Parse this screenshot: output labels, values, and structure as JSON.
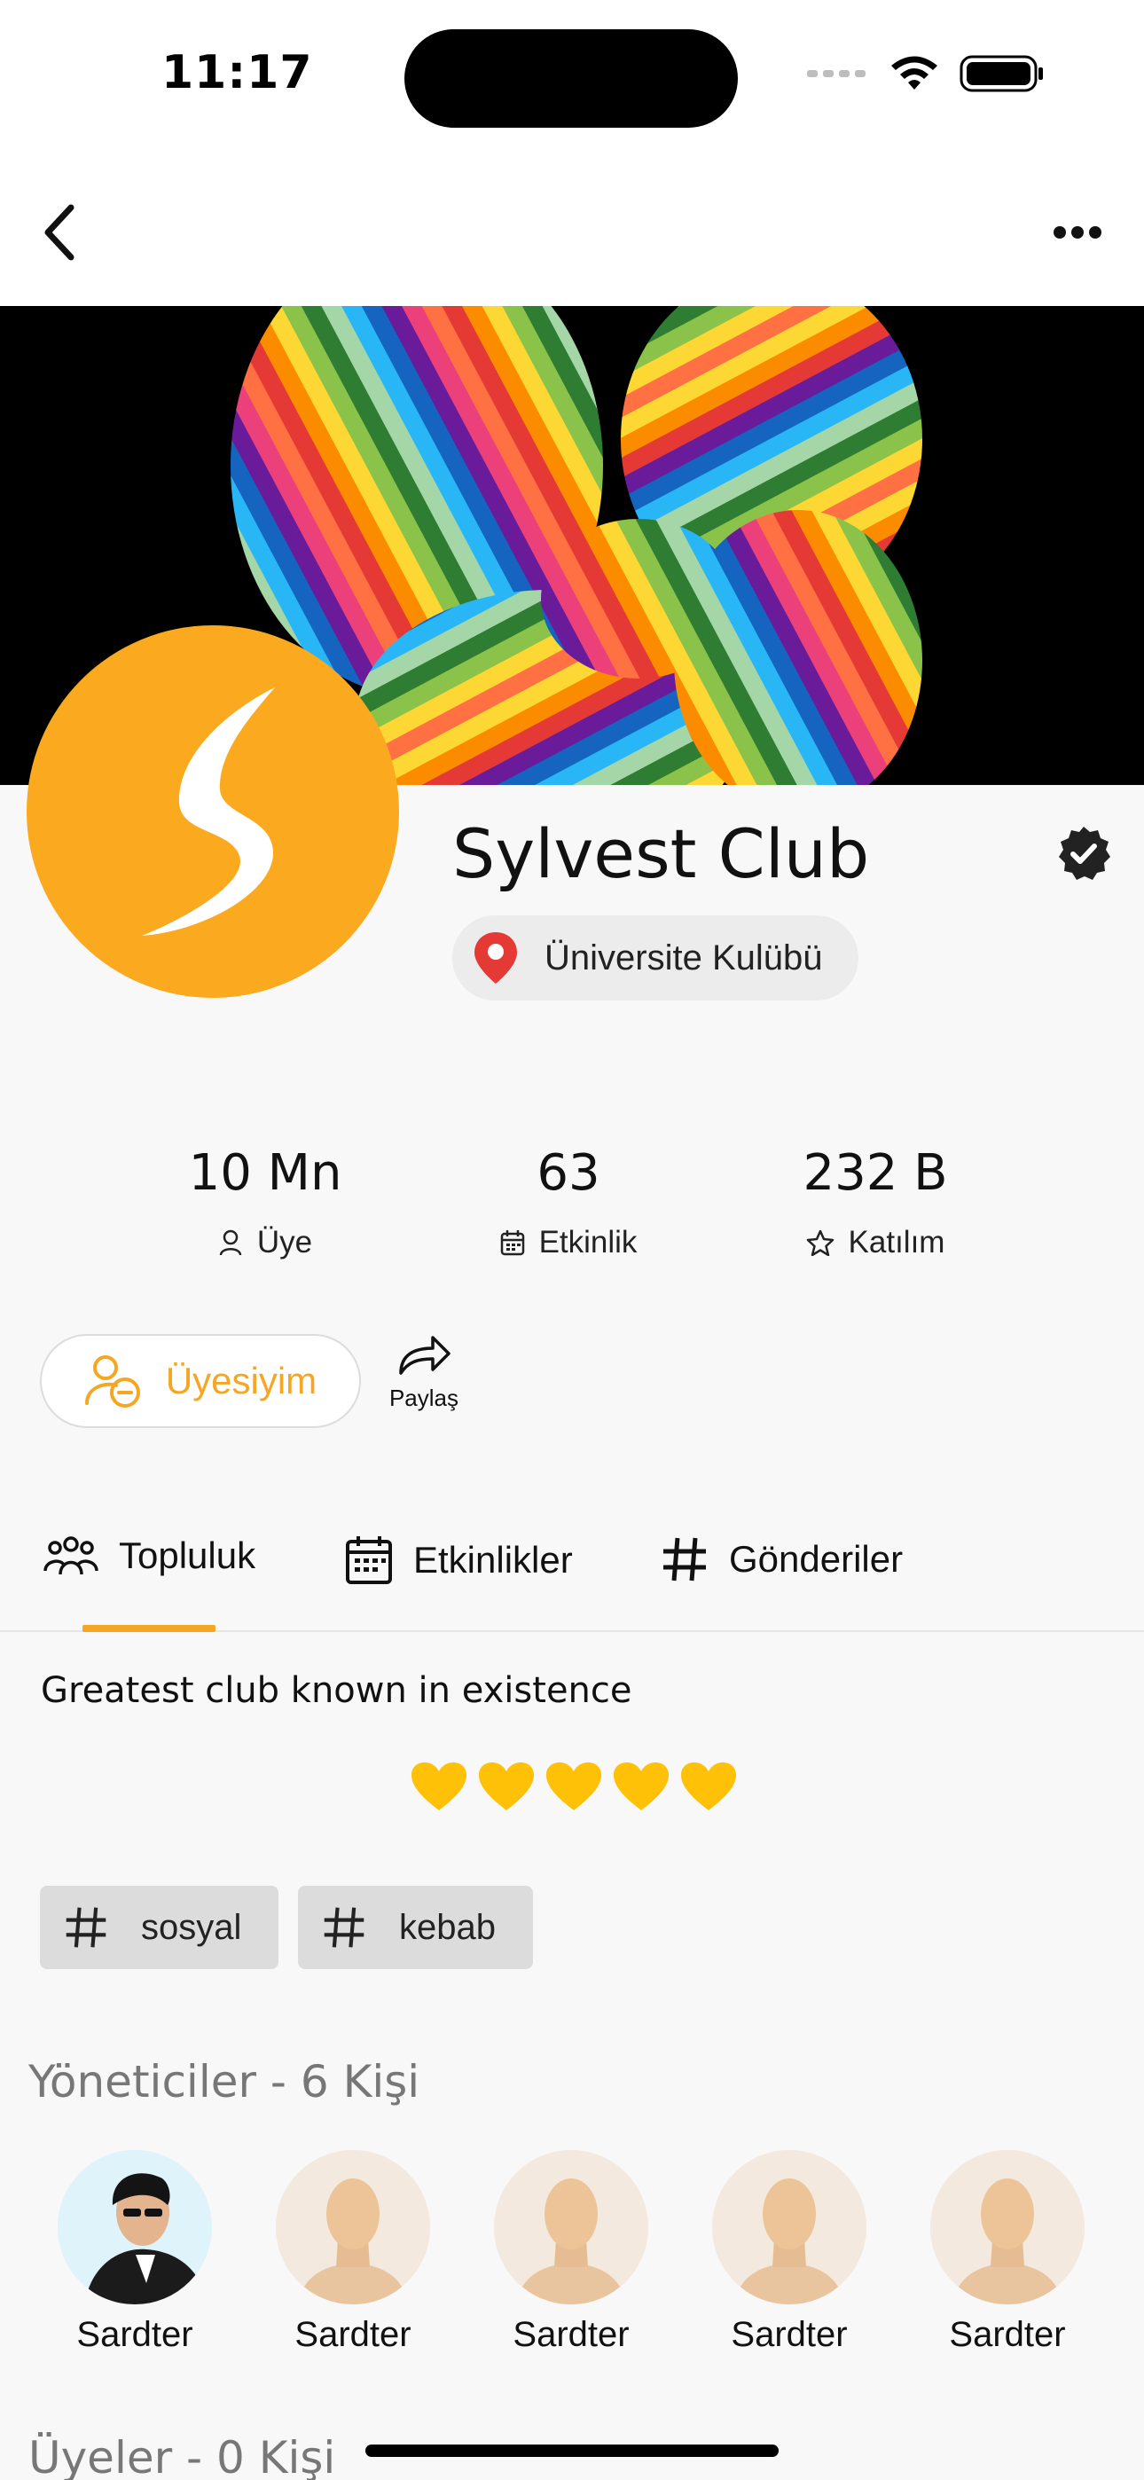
{
  "status_bar": {
    "time": "11:17"
  },
  "nav": {
    "back_icon": "chevron-left-icon",
    "more_icon": "ellipsis-icon"
  },
  "club": {
    "name": "Sylvest Club",
    "location": "Üniversite Kulübü",
    "verified": true,
    "accent_color": "#fbaa1f"
  },
  "stats": [
    {
      "value": "10 Mn",
      "label": "Üye",
      "icon": "person-icon"
    },
    {
      "value": "63",
      "label": "Etkinlik",
      "icon": "calendar-icon"
    },
    {
      "value": "232 B",
      "label": "Katılım",
      "icon": "star-icon"
    }
  ],
  "actions": {
    "member_label": "Üyesiyim",
    "share_label": "Paylaş"
  },
  "tabs": [
    {
      "label": "Topluluk",
      "icon": "people-icon",
      "active": true
    },
    {
      "label": "Etkinlikler",
      "icon": "calendar-icon",
      "active": false
    },
    {
      "label": "Gönderiler",
      "icon": "hashtag-icon",
      "active": false
    }
  ],
  "description": "Greatest club known in existence",
  "rating": {
    "hearts": 5,
    "color": "#ffc107"
  },
  "tags": [
    "sosyal",
    "kebab"
  ],
  "admins_section": {
    "title": "Yöneticiler - 6 Kişi",
    "members": [
      {
        "name": "Sardter",
        "photo": "real"
      },
      {
        "name": "Sardter",
        "photo": "placeholder"
      },
      {
        "name": "Sardter",
        "photo": "placeholder"
      },
      {
        "name": "Sardter",
        "photo": "placeholder"
      },
      {
        "name": "Sardter",
        "photo": "placeholder"
      }
    ]
  },
  "members_section": {
    "title": "Üyeler - 0 Kişi"
  }
}
